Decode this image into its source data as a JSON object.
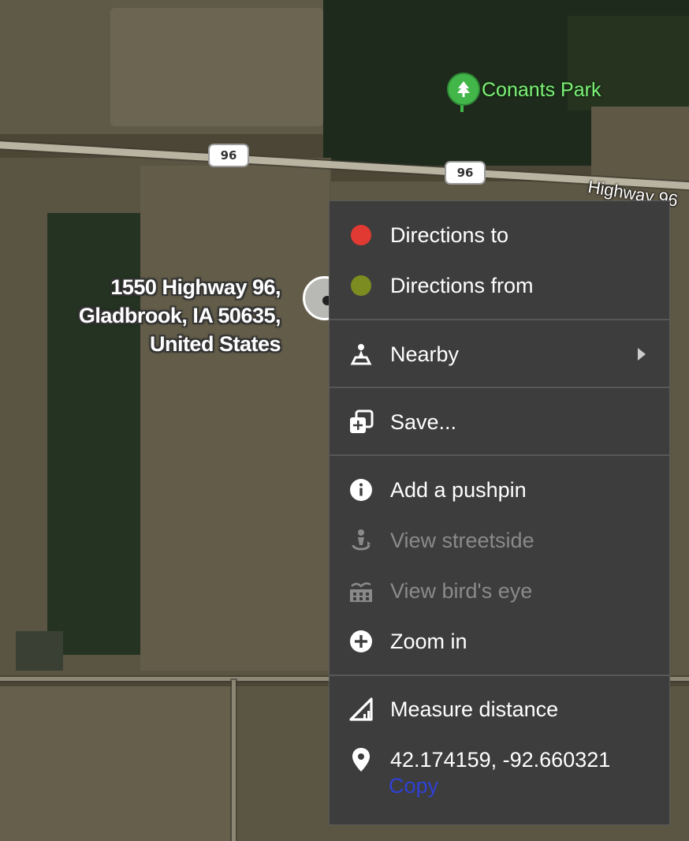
{
  "map": {
    "park_name": "Conants Park",
    "park_icon": "tree-icon",
    "highway_shield_1": "96",
    "highway_shield_2": "96",
    "highway_label": "Highway 96",
    "address_lines": [
      "1550 Highway 96,",
      "Gladbrook, IA 50635,",
      "United States"
    ]
  },
  "menu": {
    "directions_to": {
      "label": "Directions to",
      "icon": "red-dot-icon",
      "color": "#e03a33"
    },
    "directions_from": {
      "label": "Directions from",
      "icon": "green-dot-icon",
      "color": "#7d8c21"
    },
    "nearby": {
      "label": "Nearby",
      "icon": "nearby-person-icon"
    },
    "save": {
      "label": "Save...",
      "icon": "save-collection-icon"
    },
    "add_pushpin": {
      "label": "Add a pushpin",
      "icon": "info-icon"
    },
    "view_streetside": {
      "label": "View streetside",
      "icon": "streetside-icon",
      "disabled": true
    },
    "view_birds_eye": {
      "label": "View bird's eye",
      "icon": "birds-eye-icon",
      "disabled": true
    },
    "zoom_in": {
      "label": "Zoom in",
      "icon": "zoom-plus-icon"
    },
    "measure_distance": {
      "label": "Measure distance",
      "icon": "ruler-icon"
    },
    "coordinates": {
      "label": "42.174159, -92.660321",
      "icon": "location-pin-icon"
    },
    "copy": {
      "label": "Copy"
    }
  }
}
